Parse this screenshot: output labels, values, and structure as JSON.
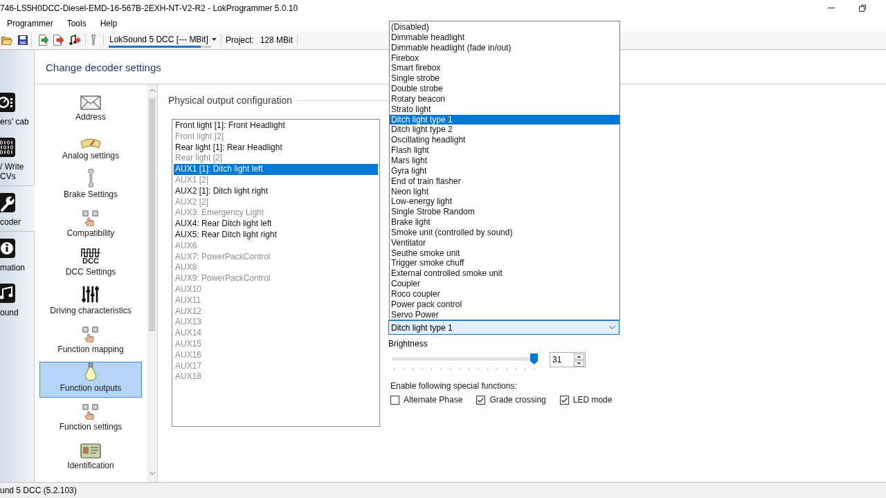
{
  "window": {
    "title": "746-LS5H0DCC-Diesel-EMD-16-567B-2EXH-NT-V2-R2 - LokProgrammer 5.0.10"
  },
  "menu": [
    "Programmer",
    "Tools",
    "Help"
  ],
  "toolbar": {
    "decoder": {
      "value": "LokSound 5 DCC [--- MBit]",
      "level": 0.9
    },
    "project_label": "Project:",
    "project_size": "128 MBit"
  },
  "categories": [
    {
      "label": "ers' cab",
      "selected": false
    },
    {
      "label": "/ Write CVs",
      "selected": false
    },
    {
      "label": "coder",
      "selected": true
    },
    {
      "label": "mation",
      "selected": false
    },
    {
      "label": "ound",
      "selected": false
    }
  ],
  "heading": "Change decoder settings",
  "settings_nav": [
    {
      "label": "Address",
      "selected": false
    },
    {
      "label": "Analog settings",
      "selected": false
    },
    {
      "label": "Brake Settings",
      "selected": false
    },
    {
      "label": "Compatibility",
      "selected": false
    },
    {
      "label": "DCC Settings",
      "icon_text": "DCC",
      "selected": false
    },
    {
      "label": "Driving characteristics",
      "selected": false
    },
    {
      "label": "Function mapping",
      "selected": false
    },
    {
      "label": "Function outputs",
      "selected": true
    },
    {
      "label": "Function settings",
      "selected": false
    },
    {
      "label": "Identification",
      "selected": false
    }
  ],
  "output_group": {
    "title": "Physical output configuration",
    "outputs": [
      {
        "label": "Front light [1]: Front Headlight",
        "disabled": false,
        "selected": false
      },
      {
        "label": "Front light [2]",
        "disabled": true,
        "selected": false
      },
      {
        "label": "Rear light [1]: Rear Headlight",
        "disabled": false,
        "selected": false
      },
      {
        "label": "Rear light [2]",
        "disabled": true,
        "selected": false
      },
      {
        "label": "AUX1 [1]: Ditch light left",
        "disabled": false,
        "selected": true
      },
      {
        "label": "AUX1 [2]",
        "disabled": true,
        "selected": false
      },
      {
        "label": "AUX2 [1]: Ditch light right",
        "disabled": false,
        "selected": false
      },
      {
        "label": "AUX2 [2]",
        "disabled": true,
        "selected": false
      },
      {
        "label": "AUX3: Emergency Light",
        "disabled": true,
        "selected": false
      },
      {
        "label": "AUX4: Rear Ditch light left",
        "disabled": false,
        "selected": false
      },
      {
        "label": "AUX5: Rear Ditch light right",
        "disabled": false,
        "selected": false
      },
      {
        "label": "AUX6",
        "disabled": true,
        "selected": false
      },
      {
        "label": "AUX7: PowerPackControl",
        "disabled": true,
        "selected": false
      },
      {
        "label": "AUX8",
        "disabled": true,
        "selected": false
      },
      {
        "label": "AUX9: PowerPackControl",
        "disabled": true,
        "selected": false
      },
      {
        "label": "AUX10",
        "disabled": true,
        "selected": false
      },
      {
        "label": "AUX11",
        "disabled": true,
        "selected": false
      },
      {
        "label": "AUX12",
        "disabled": true,
        "selected": false
      },
      {
        "label": "AUX13",
        "disabled": true,
        "selected": false
      },
      {
        "label": "AUX14",
        "disabled": true,
        "selected": false
      },
      {
        "label": "AUX15",
        "disabled": true,
        "selected": false
      },
      {
        "label": "AUX16",
        "disabled": true,
        "selected": false
      },
      {
        "label": "AUX17",
        "disabled": true,
        "selected": false
      },
      {
        "label": "AUX18",
        "disabled": true,
        "selected": false
      }
    ]
  },
  "mode_dropdown": {
    "value": "Ditch light type 1",
    "expanded": true,
    "options": [
      {
        "label": "(Disabled)",
        "selected": false
      },
      {
        "label": "Dimmable headlight",
        "selected": false
      },
      {
        "label": "Dimmable headlight (fade in/out)",
        "selected": false
      },
      {
        "label": "Firebox",
        "selected": false
      },
      {
        "label": "Smart firebox",
        "selected": false
      },
      {
        "label": "Single strobe",
        "selected": false
      },
      {
        "label": "Double strobe",
        "selected": false
      },
      {
        "label": "Rotary beacon",
        "selected": false
      },
      {
        "label": "Strato light",
        "selected": false
      },
      {
        "label": "Ditch light type 1",
        "selected": true
      },
      {
        "label": "Ditch light type 2",
        "selected": false
      },
      {
        "label": "Oscillating headlight",
        "selected": false
      },
      {
        "label": "Flash light",
        "selected": false
      },
      {
        "label": "Mars light",
        "selected": false
      },
      {
        "label": "Gyra light",
        "selected": false
      },
      {
        "label": "End of train flasher",
        "selected": false
      },
      {
        "label": "Neon light",
        "selected": false
      },
      {
        "label": "Low-energy light",
        "selected": false
      },
      {
        "label": "Single Strobe Random",
        "selected": false
      },
      {
        "label": "Brake light",
        "selected": false
      },
      {
        "label": "Smoke unit (controlled by sound)",
        "selected": false
      },
      {
        "label": "Ventilator",
        "selected": false
      },
      {
        "label": "Seuthe smoke unit",
        "selected": false
      },
      {
        "label": "Trigger smoke chuff",
        "selected": false
      },
      {
        "label": "External controlled smoke unit",
        "selected": false
      },
      {
        "label": "Coupler",
        "selected": false
      },
      {
        "label": "Roco coupler",
        "selected": false
      },
      {
        "label": "Power pack control",
        "selected": false
      },
      {
        "label": "Servo Power",
        "selected": false
      }
    ]
  },
  "brightness": {
    "label": "Brightness",
    "level": 1,
    "value": "31"
  },
  "special_functions": {
    "label": "Enable following special functions:",
    "options": [
      {
        "label": "Alternate Phase",
        "checked": false
      },
      {
        "label": "Grade crossing",
        "checked": true
      },
      {
        "label": "LED mode",
        "checked": true
      }
    ]
  },
  "status_bar": "und 5 DCC (5.2.103)"
}
